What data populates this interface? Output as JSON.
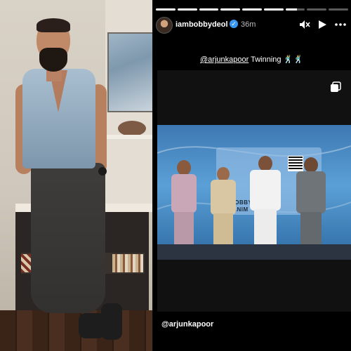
{
  "story": {
    "username": "iambobbydeol",
    "verified_mark": "✓",
    "time_ago": "36m",
    "caption_mention": "@arjunkapoor",
    "caption_text": " Twinning ",
    "caption_emoji": "🕺🕺",
    "bottom_mention": "@arjunkapoor",
    "banner_text": "BOBBY D",
    "banner_subtext": "(ANIM",
    "progress_segments": [
      1,
      1,
      1,
      1,
      1,
      1,
      0.6,
      0,
      0
    ],
    "icons": {
      "mute": "speaker-muted-icon",
      "play": "play-icon",
      "more": "more-icon",
      "multi": "multiple-photos-icon",
      "verified": "verified-badge-icon"
    },
    "colors": {
      "verified": "#3897f0",
      "backdrop": "#4a8cc8",
      "story_bg": "#000000"
    }
  }
}
